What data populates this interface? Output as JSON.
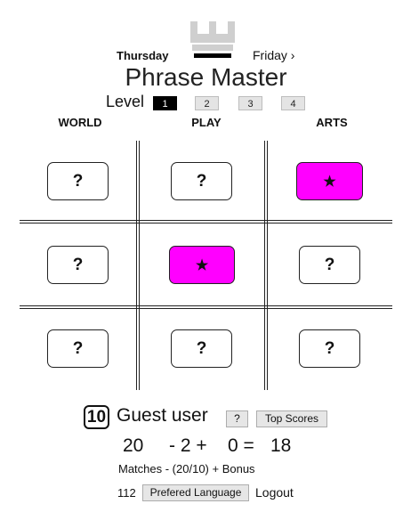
{
  "header": {
    "prev_day": "Thursday",
    "next_day": "Friday ›",
    "title": "Phrase Master",
    "level_label": "Level",
    "levels": [
      "1",
      "2",
      "3",
      "4"
    ],
    "active_level": "1",
    "categories": [
      "WORLD",
      "PLAY",
      "ARTS"
    ]
  },
  "board": {
    "hidden_symbol": "?",
    "found_symbol": "★",
    "cells": [
      [
        "?",
        "?",
        "★"
      ],
      [
        "?",
        "★",
        "?"
      ],
      [
        "?",
        "?",
        "?"
      ]
    ],
    "found_color": "#ff00ff"
  },
  "footer": {
    "score_badge": "10",
    "username": "Guest user",
    "help_label": "?",
    "top_scores_label": "Top Scores",
    "calc": {
      "matches": "20",
      "minus": "- 2 +",
      "bonus": "0 =",
      "total": "18"
    },
    "formula": "Matches - (20/10) + Bonus",
    "count": "112",
    "language_label": "Prefered Language",
    "logout_label": "Logout"
  }
}
